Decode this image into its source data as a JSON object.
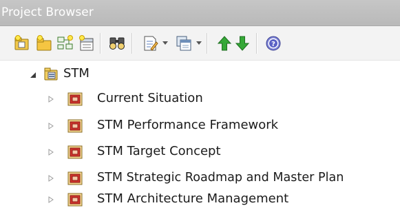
{
  "window": {
    "title": "Project Browser"
  },
  "toolbar": {
    "buttons": [
      {
        "icon": "new-model-icon"
      },
      {
        "icon": "new-package-icon"
      },
      {
        "icon": "new-diagram-icon"
      },
      {
        "icon": "new-element-icon"
      },
      {
        "icon": "find-icon"
      },
      {
        "icon": "properties-icon"
      },
      {
        "icon": "copy-icon"
      },
      {
        "icon": "move-up-icon"
      },
      {
        "icon": "move-down-icon"
      },
      {
        "icon": "help-icon"
      }
    ]
  },
  "tree": {
    "root": {
      "label": "STM",
      "icon": "model-root-icon",
      "expanded": true
    },
    "children": [
      {
        "label": "Current Situation",
        "icon": "package-icon",
        "expanded": false
      },
      {
        "label": "STM Performance Framework",
        "icon": "package-icon",
        "expanded": false
      },
      {
        "label": "STM Target Concept",
        "icon": "package-icon",
        "expanded": false
      },
      {
        "label": "STM Strategic Roadmap and Master Plan",
        "icon": "package-icon",
        "expanded": false
      },
      {
        "label": "STM Architecture Management",
        "icon": "package-icon",
        "expanded": false
      }
    ]
  },
  "colors": {
    "titlebar": "#bebebe",
    "toolbar": "#f3f3f3",
    "package_red": "#d2332d",
    "arrow_green": "#2fa12f"
  }
}
